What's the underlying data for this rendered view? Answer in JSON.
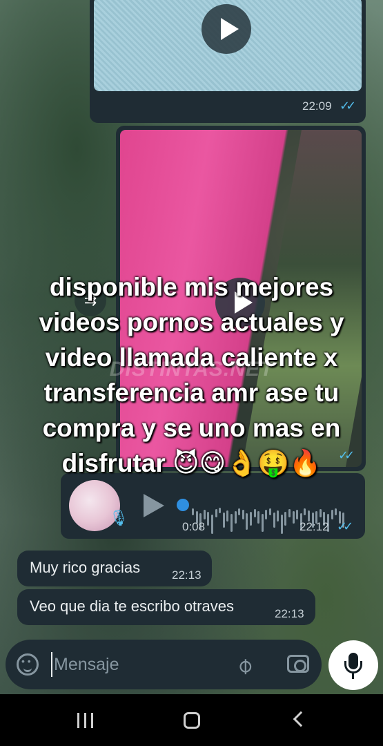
{
  "messages": {
    "video1": {
      "time": "22:09",
      "ticks": "✓✓"
    },
    "video2": {
      "ticks": "✓✓"
    },
    "overlay_text": {
      "lines": [
        "disponible mis mejores",
        "videos pornos actuales y",
        "video llamada caliente x",
        "transferencia amr ase tu",
        "compra y se uno mas en",
        "disfrutar 😈😋👌🤑🔥"
      ],
      "watermark": "DISTINTAS.NET"
    },
    "audio": {
      "duration": "0:08",
      "time": "22:12",
      "ticks": "✓✓"
    },
    "incoming": [
      {
        "text": "Muy rico gracias",
        "time": "22:13"
      },
      {
        "text": "Veo que dia te escribo otraves",
        "time": "22:13"
      }
    ]
  },
  "composer": {
    "placeholder": "Mensaje",
    "icons": [
      "sticker-icon",
      "attach-icon",
      "camera-icon",
      "mic-icon"
    ]
  },
  "navbar": {
    "icons": [
      "recents-icon",
      "home-icon",
      "back-icon"
    ]
  },
  "colors": {
    "bubble": "#1f2c34",
    "read_ticks": "#53bdeb",
    "icon_gray": "#8696a0"
  }
}
